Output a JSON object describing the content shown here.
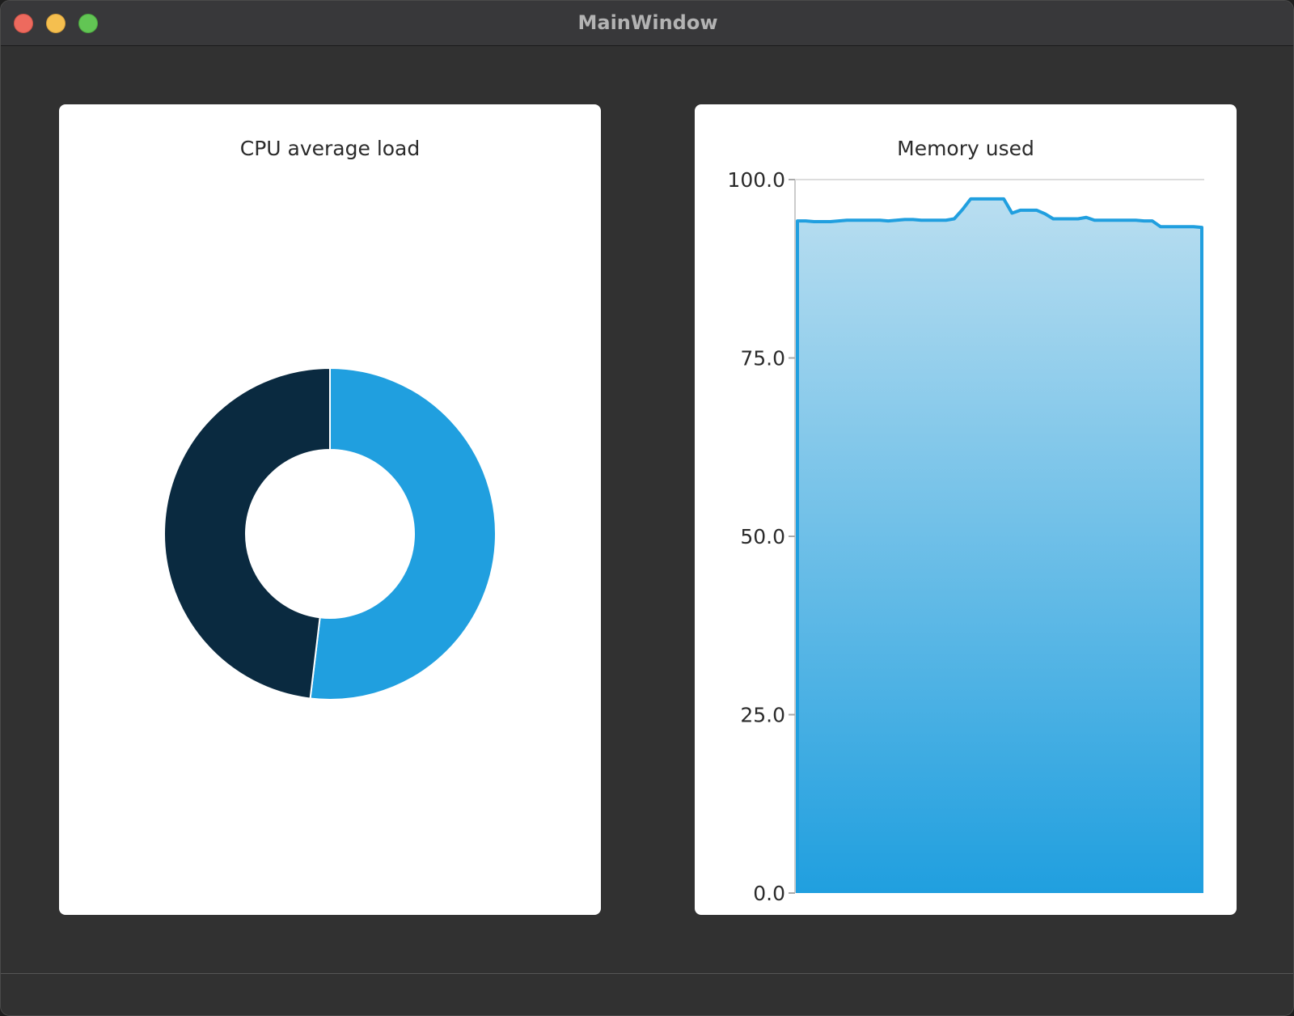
{
  "window": {
    "title": "MainWindow"
  },
  "charts": {
    "cpu_title": "CPU average load",
    "memory_title": "Memory used"
  },
  "colors": {
    "accent": "#209fdf",
    "dark": "#0a2a40",
    "window_bg": "#313131",
    "panel_bg": "#ffffff"
  },
  "chart_data": [
    {
      "type": "pie",
      "title": "CPU average load",
      "donut": true,
      "values": [
        51.9,
        48.1
      ],
      "colors": [
        "#209fdf",
        "#0a2a40"
      ]
    },
    {
      "type": "area",
      "title": "Memory used",
      "ylim": [
        0,
        100
      ],
      "yticks": [
        "100.0",
        "75.0",
        "50.0",
        "25.0",
        "0.0"
      ],
      "ytick_values": [
        100,
        75,
        50,
        25,
        0
      ],
      "x": [
        0,
        1,
        2,
        3,
        4,
        5,
        6,
        7,
        8,
        9,
        10,
        11,
        12,
        13,
        14,
        15,
        16,
        17,
        18,
        19,
        20,
        21,
        22,
        23,
        24,
        25,
        26,
        27,
        28,
        29,
        30,
        31,
        32,
        33,
        34,
        35,
        36,
        37,
        38,
        39,
        40,
        41,
        42,
        43,
        44,
        45,
        46,
        47,
        48,
        49
      ],
      "values": [
        94.2,
        94.2,
        94.1,
        94.1,
        94.1,
        94.2,
        94.3,
        94.3,
        94.3,
        94.3,
        94.3,
        94.2,
        94.3,
        94.4,
        94.4,
        94.3,
        94.3,
        94.3,
        94.3,
        94.5,
        95.8,
        97.3,
        97.3,
        97.3,
        97.3,
        97.3,
        95.3,
        95.7,
        95.7,
        95.7,
        95.2,
        94.5,
        94.5,
        94.5,
        94.5,
        94.7,
        94.3,
        94.3,
        94.3,
        94.3,
        94.3,
        94.3,
        94.2,
        94.2,
        93.4,
        93.4,
        93.4,
        93.4,
        93.4,
        93.3
      ],
      "grid": false
    }
  ]
}
